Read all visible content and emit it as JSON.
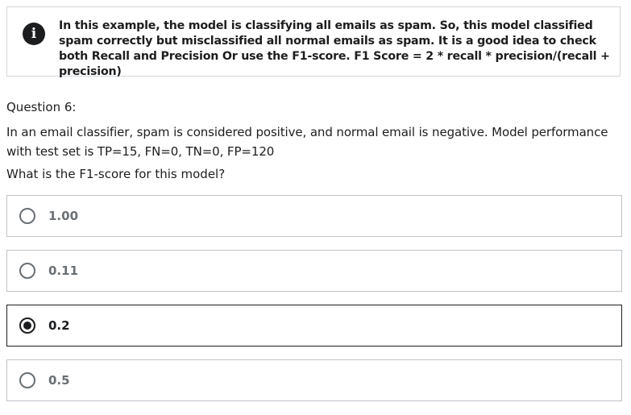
{
  "alert": {
    "icon": "info-icon",
    "text": "In this example, the model is classifying all emails as spam. So, this model classified spam correctly but misclassified all normal emails as spam. It is a good idea to check both Recall and Precision Or use the F1-score. F1 Score = 2 * recall * precision/(recall + precision)"
  },
  "question": {
    "label": "Question 6:",
    "body": "In an email classifier, spam is considered positive, and normal email is negative.  Model performance with test set is TP=15, FN=0, TN=0, FP=120",
    "prompt": "What is the F1-score for this model?"
  },
  "options": [
    {
      "label": "1.00",
      "selected": false
    },
    {
      "label": "0.11",
      "selected": false
    },
    {
      "label": "0.2",
      "selected": true
    },
    {
      "label": "0.5",
      "selected": false
    }
  ],
  "colors": {
    "text": "#1c1d1f",
    "muted": "#6a6f73",
    "border": "#bfc4c8",
    "alert_border": "#d1d7dc"
  }
}
